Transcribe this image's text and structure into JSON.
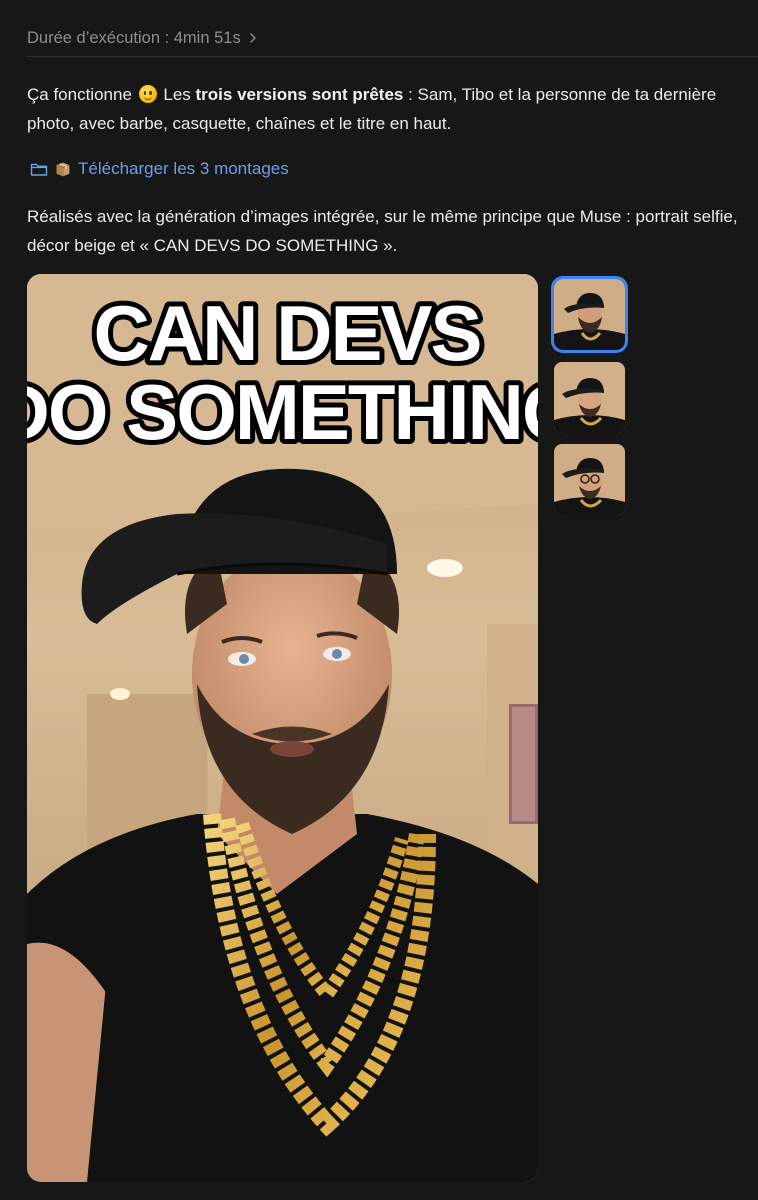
{
  "header": {
    "duration_label": "Durée d’exécution : 4min 51s"
  },
  "message": {
    "p1_prefix": "Ça fonctionne",
    "p1_pre_bold": "Les ",
    "p1_bold": "trois versions sont prêtes",
    "p1_suffix": " : Sam, Tibo et la personne de ta dernière photo, avec barbe, casquette, chaînes et le titre en haut.",
    "download_label": "Télécharger les 3 montages",
    "p2": "Réalisés avec la génération d’images intégrée, sur le même principe que Muse : portrait selfie, décor beige et « CAN DEVS DO SOMETHING »."
  },
  "image": {
    "caption_line1": "CAN DEVS",
    "caption_line2": "DO SOMETHING"
  },
  "thumbnails": {
    "selected_index": 0,
    "count": 3
  },
  "colors": {
    "background": "#171717",
    "link": "#6aa0ea",
    "selection": "#3b82f6"
  }
}
